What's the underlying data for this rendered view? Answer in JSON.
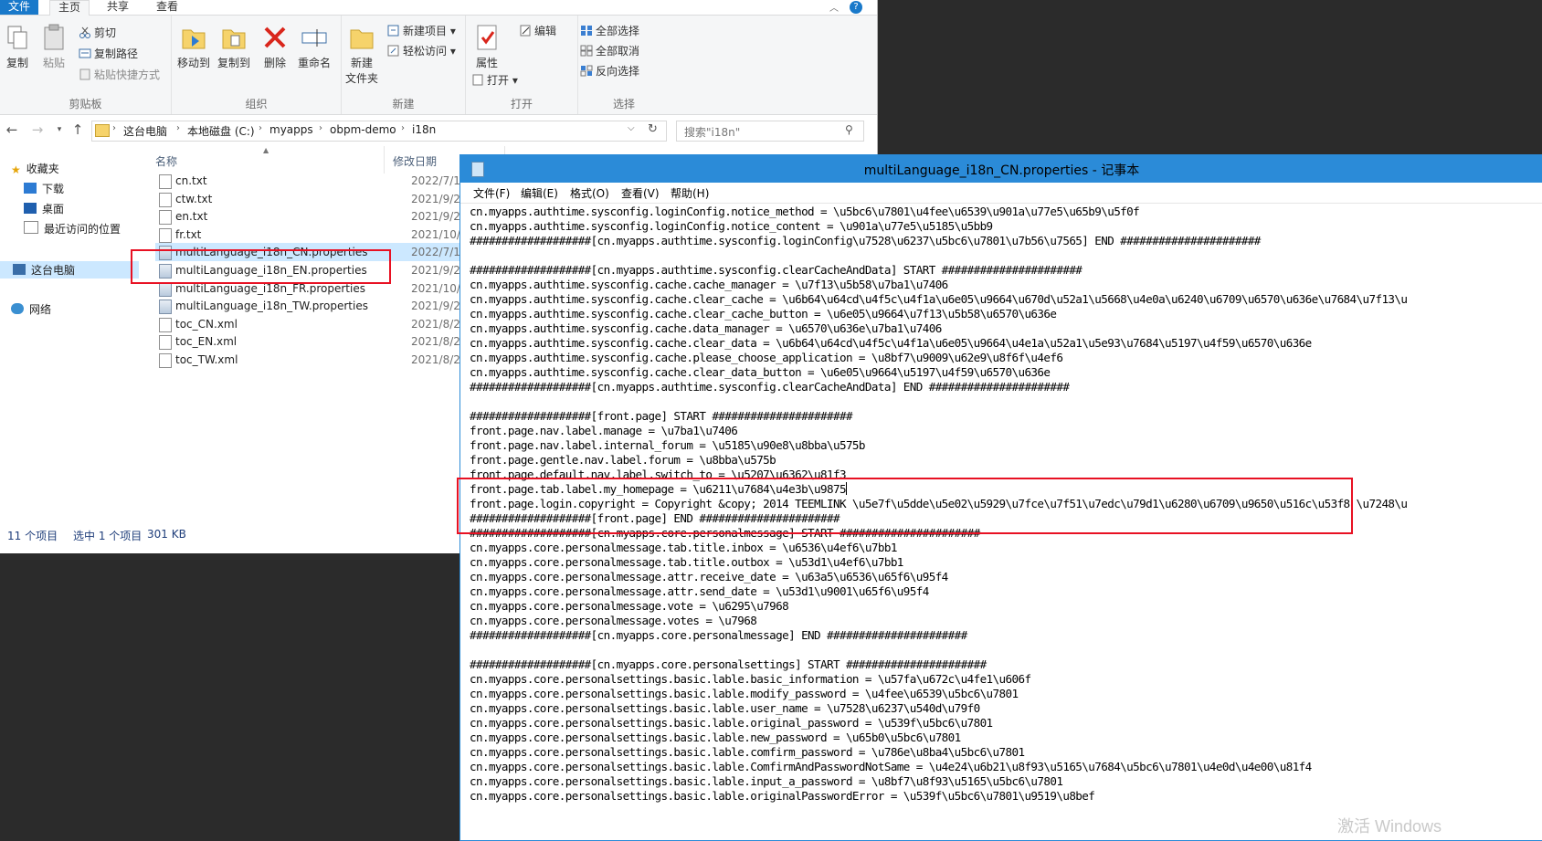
{
  "explorer": {
    "tabs": [
      "文件",
      "主页",
      "共享",
      "查看"
    ],
    "ribbon": {
      "clipboard": {
        "label": "剪贴板",
        "copy": "复制",
        "paste": "粘贴",
        "cut": "剪切",
        "copy_path": "复制路径",
        "paste_shortcut": "粘贴快捷方式"
      },
      "organize": {
        "label": "组织",
        "move_to": "移动到",
        "copy_to": "复制到",
        "delete": "删除",
        "rename": "重命名"
      },
      "new": {
        "label": "新建",
        "new_folder_line1": "新建",
        "new_folder_line2": "文件夹",
        "new_item": "新建项目",
        "easy_access": "轻松访问"
      },
      "open": {
        "label": "打开",
        "properties": "属性",
        "open": "打开",
        "edit": "编辑"
      },
      "select": {
        "label": "选择",
        "select_all": "全部选择",
        "select_none": "全部取消",
        "invert": "反向选择"
      }
    },
    "breadcrumb": [
      "这台电脑",
      "本地磁盘 (C:)",
      "myapps",
      "obpm-demo",
      "i18n"
    ],
    "search_placeholder": "搜索\"i18n\"",
    "nav": {
      "quick_access": "收藏夹",
      "downloads": "下载",
      "desktop": "桌面",
      "recent": "最近访问的位置",
      "this_pc": "这台电脑",
      "network": "网络"
    },
    "columns": {
      "name": "名称",
      "date": "修改日期"
    },
    "files": [
      {
        "name": "cn.txt",
        "date": "2022/7/11 1"
      },
      {
        "name": "ctw.txt",
        "date": "2021/9/23 9"
      },
      {
        "name": "en.txt",
        "date": "2021/9/23 9"
      },
      {
        "name": "fr.txt",
        "date": "2021/10/15"
      },
      {
        "name": "multiLanguage_i18n_CN.properties",
        "date": "2022/7/11 1"
      },
      {
        "name": "multiLanguage_i18n_EN.properties",
        "date": "2021/9/23 9"
      },
      {
        "name": "multiLanguage_i18n_FR.properties",
        "date": "2021/10/15"
      },
      {
        "name": "multiLanguage_i18n_TW.properties",
        "date": "2021/9/23 9"
      },
      {
        "name": "toc_CN.xml",
        "date": "2021/8/22 2"
      },
      {
        "name": "toc_EN.xml",
        "date": "2021/8/22 2"
      },
      {
        "name": "toc_TW.xml",
        "date": "2021/8/22 2"
      }
    ],
    "status": {
      "count": "11 个项目",
      "selected": "选中 1 个项目",
      "size": "301 KB"
    }
  },
  "notepad": {
    "title": "multiLanguage_i18n_CN.properties - 记事本",
    "menu": [
      "文件(F)",
      "编辑(E)",
      "格式(O)",
      "查看(V)",
      "帮助(H)"
    ],
    "lines": [
      "cn.myapps.authtime.sysconfig.loginConfig.notice_method = \\u5bc6\\u7801\\u4fee\\u6539\\u901a\\u77e5\\u65b9\\u5f0f",
      "cn.myapps.authtime.sysconfig.loginConfig.notice_content = \\u901a\\u77e5\\u5185\\u5bb9",
      "###################[cn.myapps.authtime.sysconfig.loginConfig\\u7528\\u6237\\u5bc6\\u7801\\u7b56\\u7565] END ######################",
      "",
      "###################[cn.myapps.authtime.sysconfig.clearCacheAndData] START ######################",
      "cn.myapps.authtime.sysconfig.cache.cache_manager = \\u7f13\\u5b58\\u7ba1\\u7406",
      "cn.myapps.authtime.sysconfig.cache.clear_cache = \\u6b64\\u64cd\\u4f5c\\u4f1a\\u6e05\\u9664\\u670d\\u52a1\\u5668\\u4e0a\\u6240\\u6709\\u6570\\u636e\\u7684\\u7f13\\u",
      "cn.myapps.authtime.sysconfig.cache.clear_cache_button = \\u6e05\\u9664\\u7f13\\u5b58\\u6570\\u636e",
      "cn.myapps.authtime.sysconfig.cache.data_manager = \\u6570\\u636e\\u7ba1\\u7406",
      "cn.myapps.authtime.sysconfig.cache.clear_data = \\u6b64\\u64cd\\u4f5c\\u4f1a\\u6e05\\u9664\\u4e1a\\u52a1\\u5e93\\u7684\\u5197\\u4f59\\u6570\\u636e",
      "cn.myapps.authtime.sysconfig.cache.please_choose_application = \\u8bf7\\u9009\\u62e9\\u8f6f\\u4ef6",
      "cn.myapps.authtime.sysconfig.cache.clear_data_button = \\u6e05\\u9664\\u5197\\u4f59\\u6570\\u636e",
      "###################[cn.myapps.authtime.sysconfig.clearCacheAndData] END ######################",
      "",
      "###################[front.page] START ######################",
      "front.page.nav.label.manage = \\u7ba1\\u7406",
      "front.page.nav.label.internal_forum = \\u5185\\u90e8\\u8bba\\u575b",
      "front.page.gentle.nav.label.forum = \\u8bba\\u575b",
      "front.page.default.nav.label.switch_to = \\u5207\\u6362\\u81f3",
      "front.page.tab.label.my_homepage = \\u6211\\u7684\\u4e3b\\u9875",
      "front.page.login.copyright = Copyright &copy; 2014 TEEMLINK \\u5e7f\\u5dde\\u5e02\\u5929\\u7fce\\u7f51\\u7edc\\u79d1\\u6280\\u6709\\u9650\\u516c\\u53f8 \\u7248\\u",
      "###################[front.page] END ######################",
      "###################[cn.myapps.core.personalmessage] START ######################",
      "cn.myapps.core.personalmessage.tab.title.inbox = \\u6536\\u4ef6\\u7bb1",
      "cn.myapps.core.personalmessage.tab.title.outbox = \\u53d1\\u4ef6\\u7bb1",
      "cn.myapps.core.personalmessage.attr.receive_date = \\u63a5\\u6536\\u65f6\\u95f4",
      "cn.myapps.core.personalmessage.attr.send_date = \\u53d1\\u9001\\u65f6\\u95f4",
      "cn.myapps.core.personalmessage.vote = \\u6295\\u7968",
      "cn.myapps.core.personalmessage.votes = \\u7968",
      "###################[cn.myapps.core.personalmessage] END ######################",
      "",
      "###################[cn.myapps.core.personalsettings] START ######################",
      "cn.myapps.core.personalsettings.basic.lable.basic_information = \\u57fa\\u672c\\u4fe1\\u606f",
      "cn.myapps.core.personalsettings.basic.lable.modify_password = \\u4fee\\u6539\\u5bc6\\u7801",
      "cn.myapps.core.personalsettings.basic.lable.user_name = \\u7528\\u6237\\u540d\\u79f0",
      "cn.myapps.core.personalsettings.basic.lable.original_password = \\u539f\\u5bc6\\u7801",
      "cn.myapps.core.personalsettings.basic.lable.new_password = \\u65b0\\u5bc6\\u7801",
      "cn.myapps.core.personalsettings.basic.lable.comfirm_password = \\u786e\\u8ba4\\u5bc6\\u7801",
      "cn.myapps.core.personalsettings.basic.lable.ComfirmAndPasswordNotSame = \\u4e24\\u6b21\\u8f93\\u5165\\u7684\\u5bc6\\u7801\\u4e0d\\u4e00\\u81f4",
      "cn.myapps.core.personalsettings.basic.lable.input_a_password = \\u8bf7\\u8f93\\u5165\\u5bc6\\u7801",
      "cn.myapps.core.personalsettings.basic.lable.originalPasswordError = \\u539f\\u5bc6\\u7801\\u9519\\u8bef"
    ]
  },
  "watermark": "激活 Windows"
}
